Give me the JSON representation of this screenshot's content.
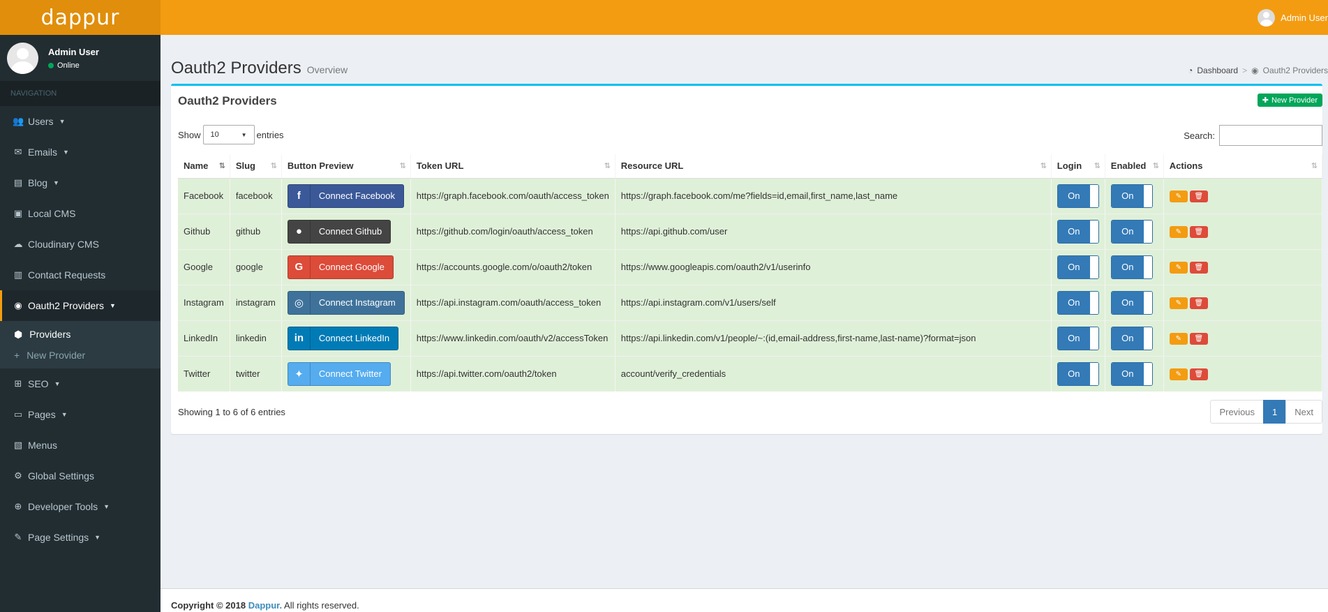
{
  "brand": {
    "logo_text": "dappur"
  },
  "header": {
    "user_name": "Admin User"
  },
  "sidebar": {
    "user_name": "Admin User",
    "user_status": "Online",
    "nav_header": "NAVIGATION",
    "items": [
      {
        "label": "Users",
        "icon": "users-icon"
      },
      {
        "label": "Emails",
        "icon": "envelope-icon"
      },
      {
        "label": "Blog",
        "icon": "newspaper-icon"
      },
      {
        "label": "Local CMS",
        "icon": "image-icon"
      },
      {
        "label": "Cloudinary CMS",
        "icon": "cloud-icon"
      },
      {
        "label": "Contact Requests",
        "icon": "address-book-icon"
      },
      {
        "label": "Oauth2 Providers",
        "icon": "user-circle-icon"
      },
      {
        "label": "SEO",
        "icon": "sitemap-icon"
      },
      {
        "label": "Pages",
        "icon": "book-icon"
      },
      {
        "label": "Menus",
        "icon": "map-icon"
      },
      {
        "label": "Global Settings",
        "icon": "cogs-icon"
      },
      {
        "label": "Developer Tools",
        "icon": "globe-icon"
      },
      {
        "label": "Page Settings",
        "icon": "wrench-icon"
      }
    ],
    "submenu": [
      {
        "label": "Providers",
        "icon": "cube-icon"
      },
      {
        "label": "New Provider",
        "icon": "plus-icon"
      }
    ]
  },
  "content": {
    "title": "Oauth2 Providers",
    "subtitle": "Overview",
    "breadcrumb": [
      "Dashboard",
      "Oauth2 Providers"
    ]
  },
  "box": {
    "title": "Oauth2 Providers",
    "new_button": "New Provider",
    "show_label": "Show",
    "entries_label": "entries",
    "page_length": "10",
    "search_label": "Search:",
    "search_value": "",
    "info": "Showing 1 to 6 of 6 entries",
    "pager": {
      "previous": "Previous",
      "current": "1",
      "next": "Next"
    }
  },
  "table": {
    "columns": [
      "Name",
      "Slug",
      "Button Preview",
      "Token URL",
      "Resource URL",
      "Login",
      "Enabled",
      "Actions"
    ],
    "rows": [
      {
        "name": "Facebook",
        "slug": "facebook",
        "button": "Connect Facebook",
        "icon_glyph": "f",
        "color": "#3b5998",
        "token_url": "https://graph.facebook.com/oauth/access_token",
        "resource_url": "https://graph.facebook.com/me?fields=id,email,first_name,last_name",
        "login": "On",
        "enabled": "On"
      },
      {
        "name": "Github",
        "slug": "github",
        "button": "Connect Github",
        "icon_glyph": "●",
        "color": "#444444",
        "token_url": "https://github.com/login/oauth/access_token",
        "resource_url": "https://api.github.com/user",
        "login": "On",
        "enabled": "On"
      },
      {
        "name": "Google",
        "slug": "google",
        "button": "Connect Google",
        "icon_glyph": "G",
        "color": "#dd4b39",
        "token_url": "https://accounts.google.com/o/oauth2/token",
        "resource_url": "https://www.googleapis.com/oauth2/v1/userinfo",
        "login": "On",
        "enabled": "On"
      },
      {
        "name": "Instagram",
        "slug": "instagram",
        "button": "Connect Instagram",
        "icon_glyph": "◎",
        "color": "#3f729b",
        "token_url": "https://api.instagram.com/oauth/access_token",
        "resource_url": "https://api.instagram.com/v1/users/self",
        "login": "On",
        "enabled": "On"
      },
      {
        "name": "LinkedIn",
        "slug": "linkedin",
        "button": "Connect LinkedIn",
        "icon_glyph": "in",
        "color": "#007bb6",
        "token_url": "https://www.linkedin.com/oauth/v2/accessToken",
        "resource_url": "https://api.linkedin.com/v1/people/~:(id,email-address,first-name,last-name)?format=json",
        "login": "On",
        "enabled": "On"
      },
      {
        "name": "Twitter",
        "slug": "twitter",
        "button": "Connect Twitter",
        "icon_glyph": "✦",
        "color": "#55acee",
        "token_url": "https://api.twitter.com/oauth2/token",
        "resource_url": "account/verify_credentials",
        "login": "On",
        "enabled": "On"
      }
    ]
  },
  "footer": {
    "prefix": "Copyright © 2018",
    "brand": "Dappur.",
    "suffix": "All rights reserved."
  }
}
